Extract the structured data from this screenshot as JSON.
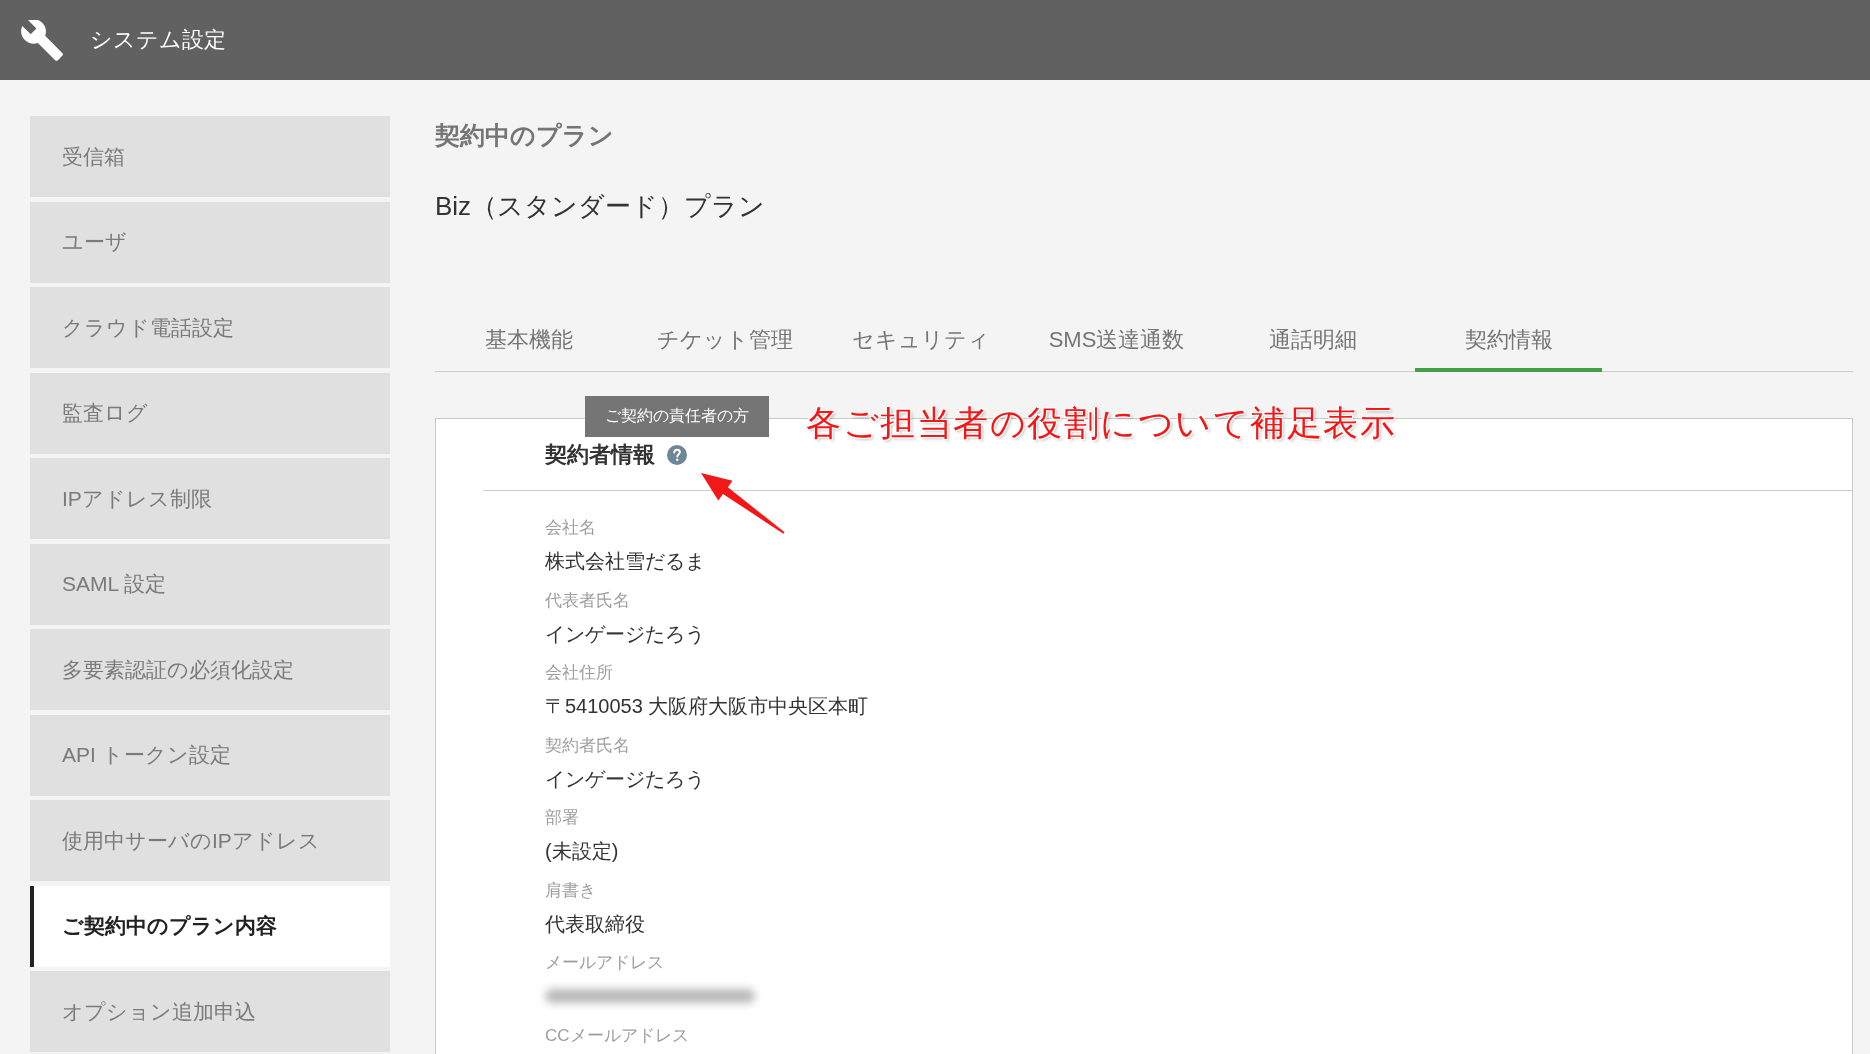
{
  "header": {
    "title": "システム設定"
  },
  "sidebar": {
    "items": [
      {
        "label": "受信箱",
        "selected": false
      },
      {
        "label": "ユーザ",
        "selected": false
      },
      {
        "label": "クラウド電話設定",
        "selected": false
      },
      {
        "label": "監査ログ",
        "selected": false
      },
      {
        "label": "IPアドレス制限",
        "selected": false
      },
      {
        "label": "SAML 設定",
        "selected": false
      },
      {
        "label": "多要素認証の必須化設定",
        "selected": false
      },
      {
        "label": "API トークン設定",
        "selected": false
      },
      {
        "label": "使用中サーバのIPアドレス",
        "selected": false
      },
      {
        "label": "ご契約中のプラン内容",
        "selected": true
      },
      {
        "label": "オプション追加申込",
        "selected": false
      }
    ]
  },
  "page": {
    "title": "契約中のプラン",
    "plan": "Biz（スタンダード）プラン"
  },
  "tabs": [
    {
      "label": "基本機能",
      "selected": false
    },
    {
      "label": "チケット管理",
      "selected": false
    },
    {
      "label": "セキュリティ",
      "selected": false
    },
    {
      "label": "SMS送達通数",
      "selected": false
    },
    {
      "label": "通話明細",
      "selected": false
    },
    {
      "label": "契約情報",
      "selected": true
    }
  ],
  "contract_card": {
    "title": "契約者情報",
    "tooltip": "ご契約の責任者の方",
    "fields": [
      {
        "kind": "text",
        "label": "会社名",
        "value": "株式会社雪だるま"
      },
      {
        "kind": "text",
        "label": "代表者氏名",
        "value": "インゲージたろう"
      },
      {
        "kind": "text",
        "label": "会社住所",
        "value": "〒5410053 大阪府大阪市中央区本町"
      },
      {
        "kind": "text",
        "label": "契約者氏名",
        "value": "インゲージたろう"
      },
      {
        "kind": "text",
        "label": "部署",
        "value": "(未設定)"
      },
      {
        "kind": "text",
        "label": "肩書き",
        "value": "代表取締役"
      },
      {
        "kind": "blurred",
        "label": "メールアドレス"
      },
      {
        "kind": "text",
        "label": "CCメールアドレス"
      }
    ]
  },
  "annotation": {
    "text": "各ご担当者の役割について補足表示"
  }
}
